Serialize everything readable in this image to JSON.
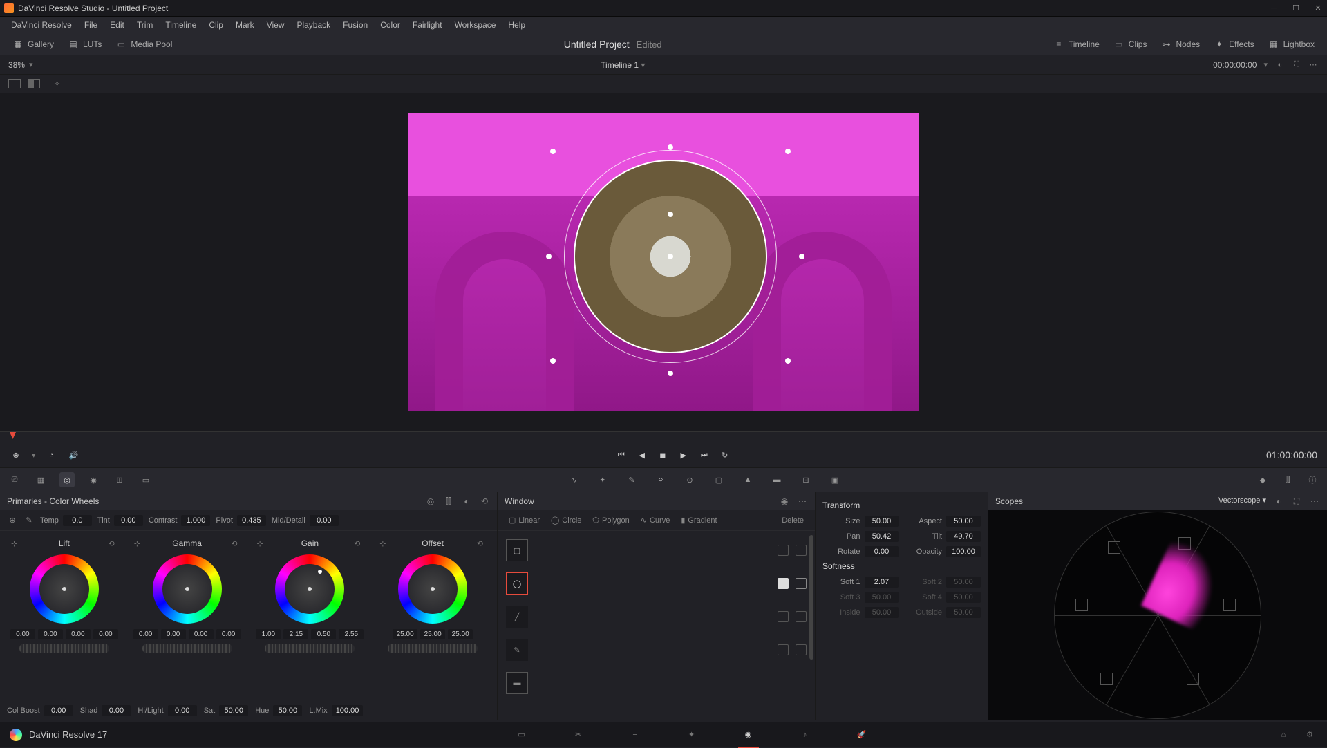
{
  "titlebar": {
    "text": "DaVinci Resolve Studio - Untitled Project"
  },
  "menu": [
    "DaVinci Resolve",
    "File",
    "Edit",
    "Trim",
    "Timeline",
    "Clip",
    "Mark",
    "View",
    "Playback",
    "Fusion",
    "Color",
    "Fairlight",
    "Workspace",
    "Help"
  ],
  "toolbar": {
    "left": [
      "Gallery",
      "LUTs",
      "Media Pool"
    ],
    "project": "Untitled Project",
    "edited": "Edited",
    "right": [
      "Timeline",
      "Clips",
      "Nodes",
      "Effects",
      "Lightbox"
    ]
  },
  "zoombar": {
    "zoom": "38%",
    "timeline": "Timeline 1",
    "tc": "00:00:00:00"
  },
  "transport": {
    "tc": "01:00:00:00"
  },
  "primaries": {
    "title": "Primaries - Color Wheels",
    "temp": {
      "label": "Temp",
      "val": "0.0"
    },
    "tint": {
      "label": "Tint",
      "val": "0.00"
    },
    "contrast": {
      "label": "Contrast",
      "val": "1.000"
    },
    "pivot": {
      "label": "Pivot",
      "val": "0.435"
    },
    "middetail": {
      "label": "Mid/Detail",
      "val": "0.00"
    },
    "wheels": [
      {
        "name": "Lift",
        "vals": [
          "0.00",
          "0.00",
          "0.00",
          "0.00"
        ]
      },
      {
        "name": "Gamma",
        "vals": [
          "0.00",
          "0.00",
          "0.00",
          "0.00"
        ]
      },
      {
        "name": "Gain",
        "vals": [
          "1.00",
          "2.15",
          "0.50",
          "2.55"
        ]
      },
      {
        "name": "Offset",
        "vals": [
          "25.00",
          "25.00",
          "25.00"
        ]
      }
    ],
    "bottom": {
      "colboost": {
        "label": "Col Boost",
        "val": "0.00"
      },
      "shad": {
        "label": "Shad",
        "val": "0.00"
      },
      "hilight": {
        "label": "Hi/Light",
        "val": "0.00"
      },
      "sat": {
        "label": "Sat",
        "val": "50.00"
      },
      "hue": {
        "label": "Hue",
        "val": "50.00"
      },
      "lmix": {
        "label": "L.Mix",
        "val": "100.00"
      }
    }
  },
  "window": {
    "title": "Window",
    "shapes": [
      "Linear",
      "Circle",
      "Polygon",
      "Curve",
      "Gradient",
      "Delete"
    ]
  },
  "transform": {
    "title": "Transform",
    "size": {
      "label": "Size",
      "val": "50.00"
    },
    "aspect": {
      "label": "Aspect",
      "val": "50.00"
    },
    "pan": {
      "label": "Pan",
      "val": "50.42"
    },
    "tilt": {
      "label": "Tilt",
      "val": "49.70"
    },
    "rotate": {
      "label": "Rotate",
      "val": "0.00"
    },
    "opacity": {
      "label": "Opacity",
      "val": "100.00"
    },
    "softness_title": "Softness",
    "soft1": {
      "label": "Soft 1",
      "val": "2.07"
    },
    "soft2": {
      "label": "Soft 2",
      "val": "50.00"
    },
    "soft3": {
      "label": "Soft 3",
      "val": "50.00"
    },
    "soft4": {
      "label": "Soft 4",
      "val": "50.00"
    },
    "inside": {
      "label": "Inside",
      "val": "50.00"
    },
    "outside": {
      "label": "Outside",
      "val": "50.00"
    }
  },
  "scopes": {
    "title": "Scopes",
    "type": "Vectorscope"
  },
  "pagenav": {
    "version": "DaVinci Resolve 17"
  }
}
